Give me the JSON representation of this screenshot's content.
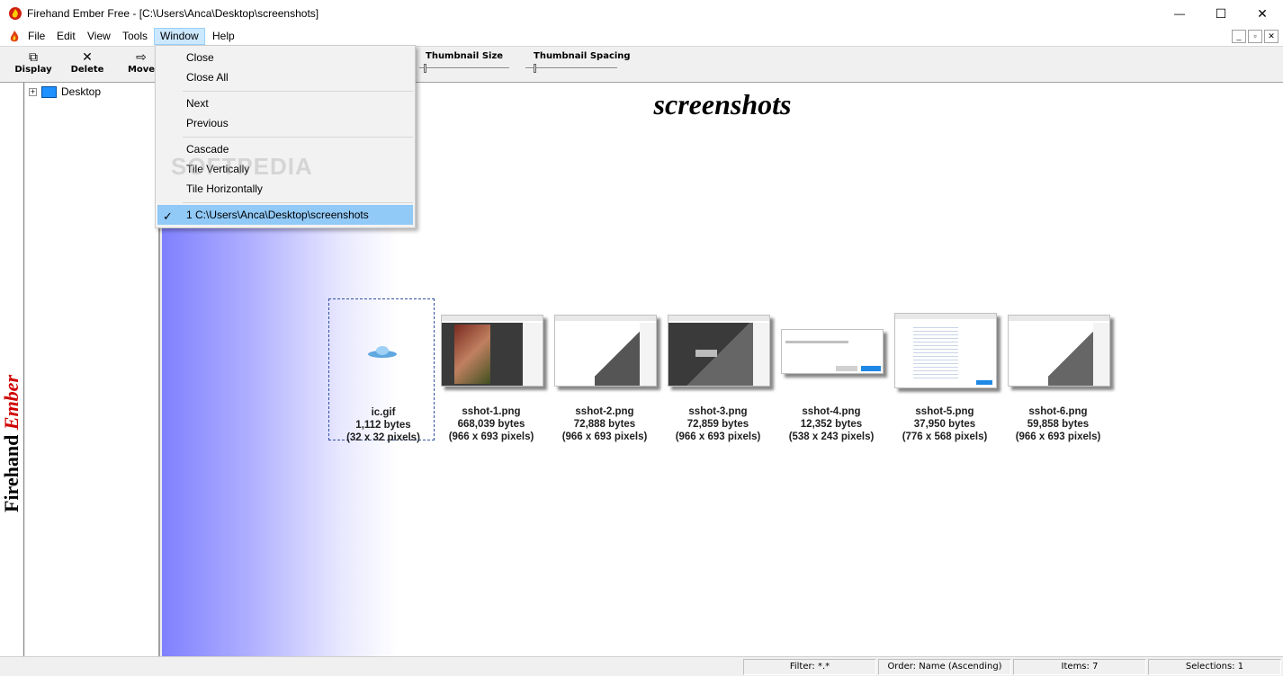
{
  "window": {
    "title": "Firehand Ember Free - [C:\\Users\\Anca\\Desktop\\screenshots]",
    "minimize_glyph": "—",
    "maximize_glyph": "☐",
    "close_glyph": "✕"
  },
  "menubar": {
    "items": [
      "File",
      "Edit",
      "View",
      "Tools",
      "Window",
      "Help"
    ],
    "active": "Window",
    "mdi_buttons": [
      "_",
      "▫",
      "✕"
    ]
  },
  "toolbar": {
    "buttons": [
      {
        "label": "Display",
        "icon": "display-icon",
        "glyph": "⧉"
      },
      {
        "label": "Delete",
        "icon": "delete-icon",
        "glyph": "✕"
      },
      {
        "label": "Move",
        "icon": "move-icon",
        "glyph": "⇨"
      }
    ],
    "sliders": [
      {
        "label": "Thumbnail Size"
      },
      {
        "label": "Thumbnail Spacing"
      }
    ]
  },
  "brand": {
    "part1": "Firehand",
    "part2": "Ember"
  },
  "tree": {
    "expander": "+",
    "root": "Desktop"
  },
  "content": {
    "folder_title": "screenshots",
    "thumbnails": [
      {
        "name": "ic.gif",
        "size": "1,112 bytes",
        "dims": "(32 x 32 pixels)",
        "selected": true
      },
      {
        "name": "sshot-1.png",
        "size": "668,039 bytes",
        "dims": "(966 x 693 pixels)"
      },
      {
        "name": "sshot-2.png",
        "size": "72,888 bytes",
        "dims": "(966 x 693 pixels)"
      },
      {
        "name": "sshot-3.png",
        "size": "72,859 bytes",
        "dims": "(966 x 693 pixels)"
      },
      {
        "name": "sshot-4.png",
        "size": "12,352 bytes",
        "dims": "(538 x 243 pixels)"
      },
      {
        "name": "sshot-5.png",
        "size": "37,950 bytes",
        "dims": "(776 x 568 pixels)"
      },
      {
        "name": "sshot-6.png",
        "size": "59,858 bytes",
        "dims": "(966 x 693 pixels)"
      }
    ]
  },
  "window_menu": {
    "items": [
      "Close",
      "Close All",
      "Next",
      "Previous",
      "Cascade",
      "Tile Vertically",
      "Tile Horizontally",
      "1 C:\\Users\\Anca\\Desktop\\screenshots"
    ],
    "checked_glyph": "✓"
  },
  "watermark": "SOFTPEDIA",
  "statusbar": {
    "filter": "Filter: *.*",
    "order": "Order: Name (Ascending)",
    "items": "Items: 7",
    "selections": "Selections: 1"
  },
  "colors": {
    "accent": "#8080ff",
    "menu_highlight": "#cce8ff",
    "checked_item": "#91c9f7",
    "brand_red": "#d00000"
  }
}
